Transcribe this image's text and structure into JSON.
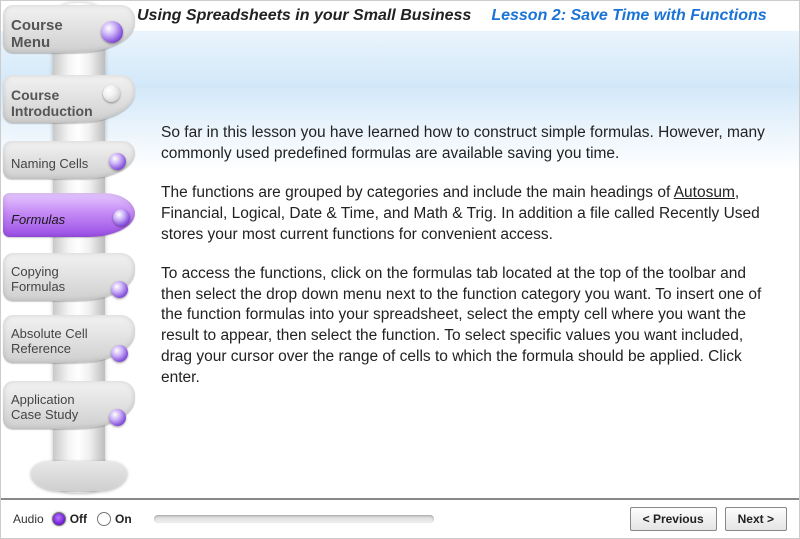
{
  "header": {
    "course_title": "Using Spreadsheets in your Small Business",
    "lesson_title": "Lesson 2: Save Time with Functions"
  },
  "sidebar": {
    "items": [
      {
        "label": "Course Menu"
      },
      {
        "label": "Course Introduction"
      },
      {
        "label": "Naming Cells"
      },
      {
        "label": "Formulas"
      },
      {
        "label": "Copying Formulas"
      },
      {
        "label": "Absolute Cell Reference"
      },
      {
        "label": "Application Case Study"
      }
    ],
    "active_index": 3
  },
  "content": {
    "p1": "So far in this lesson  you have learned how to construct simple formulas. However, many  commonly used  predefined formulas are available saving you time.",
    "p2a": "The functions are grouped by categories and include the main headings of ",
    "p2_link": "Autosum",
    "p2b": ", Financial, Logical, Date & Time, and Math & Trig. In addition a file called Recently Used stores your most current functions for convenient access.",
    "p3": "To access the functions, click on the formulas tab located at the top of the toolbar and then select the drop down menu next to the function category you want. To insert one of the function formulas into your spreadsheet, select the empty cell  where you want the result to appear, then select the function. To select specific values  you want included, drag your cursor over the range of cells to which the formula should be applied.  Click enter."
  },
  "footer": {
    "audio_label": "Audio",
    "off_label": "Off",
    "on_label": "On",
    "audio_state": "off",
    "prev_label": "< Previous",
    "next_label": "Next >"
  }
}
